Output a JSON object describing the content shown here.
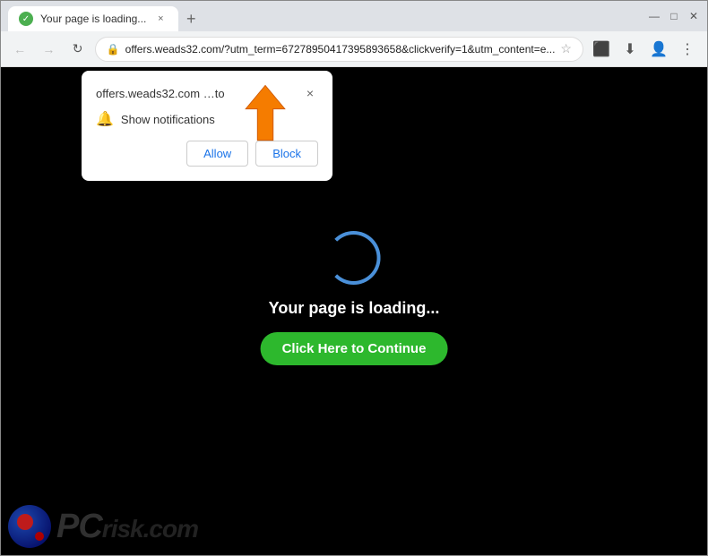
{
  "browser": {
    "tab": {
      "title": "Your page is loading...",
      "close_label": "×"
    },
    "new_tab_label": "+",
    "window_controls": {
      "minimize": "—",
      "maximize": "□",
      "close": "✕"
    },
    "nav": {
      "back": "←",
      "forward": "→",
      "reload": "↻",
      "address": "offers.weads32.com/?utm_term=67278950417395893658&clickverify=1&utm_content=e...",
      "address_full": "offers.weads32.com/?utm_term=67278950417395893658&clickverify=1&utm_content=e..."
    }
  },
  "notification_popup": {
    "site": "offers.weads32.com",
    "site_suffix": "…to",
    "message": "Show notifications",
    "allow_label": "Allow",
    "block_label": "Block",
    "close_label": "×"
  },
  "page": {
    "loading_text": "Your page is loading...",
    "continue_label": "Click Here to Continue"
  },
  "logo": {
    "text": "risk.com",
    "pc_text": "PC"
  },
  "colors": {
    "accent_green": "#2db82d",
    "spinner_blue": "#4a90d9",
    "arrow_orange": "#f57c00",
    "page_bg": "#000000"
  }
}
